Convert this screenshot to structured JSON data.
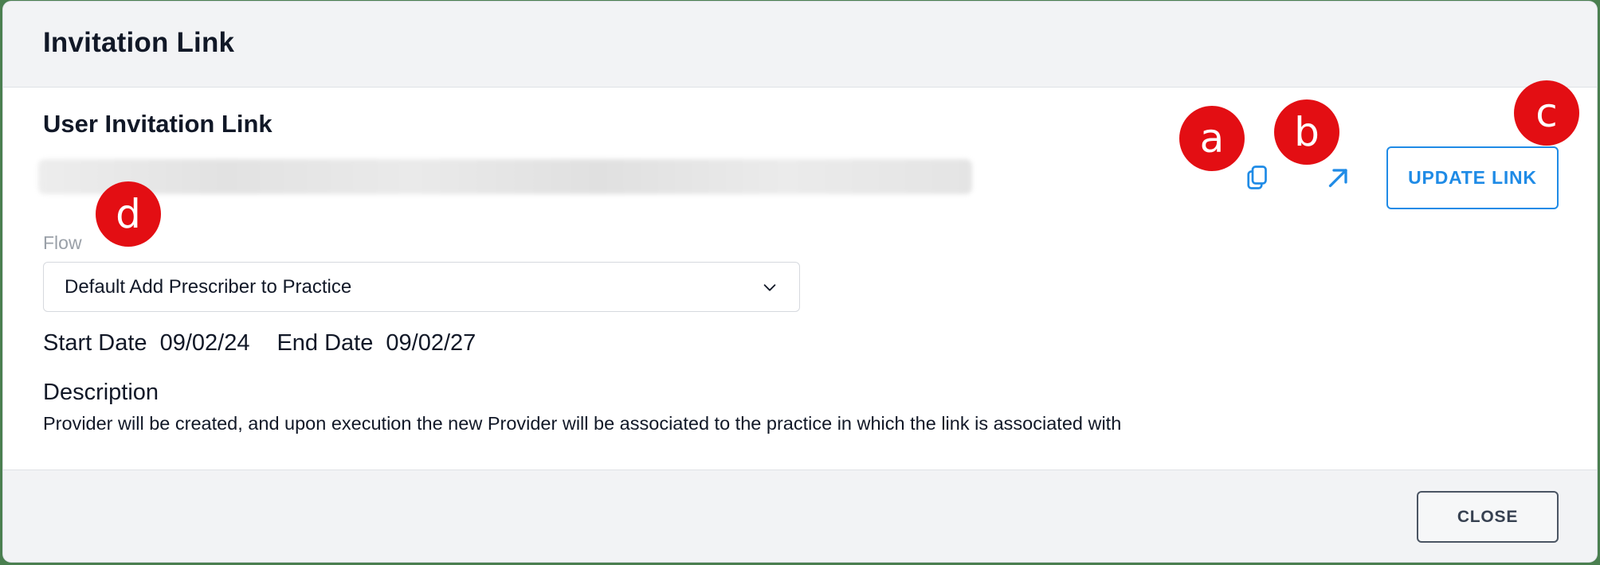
{
  "dialog": {
    "title": "Invitation Link"
  },
  "section": {
    "title": "User Invitation Link"
  },
  "actions": {
    "copy_icon": "copy-icon",
    "open_icon": "arrow-up-right-icon",
    "update_label": "UPDATE LINK"
  },
  "flow": {
    "label": "Flow",
    "selected": "Default Add Prescriber to Practice",
    "chevron_icon": "chevron-down-icon"
  },
  "dates": {
    "start_label": "Start Date",
    "start_value": "09/02/24",
    "end_label": "End Date",
    "end_value": "09/02/27"
  },
  "description": {
    "title": "Description",
    "text": "Provider will be created, and upon execution the new Provider will be associated to the practice in which the link is associated with"
  },
  "footer": {
    "close_label": "CLOSE"
  },
  "markers": {
    "a": "a",
    "b": "b",
    "c": "c",
    "d": "d"
  },
  "colors": {
    "accent": "#1f8be6",
    "marker": "#e30e13",
    "header_bg": "#f2f3f5",
    "text": "#111827"
  }
}
